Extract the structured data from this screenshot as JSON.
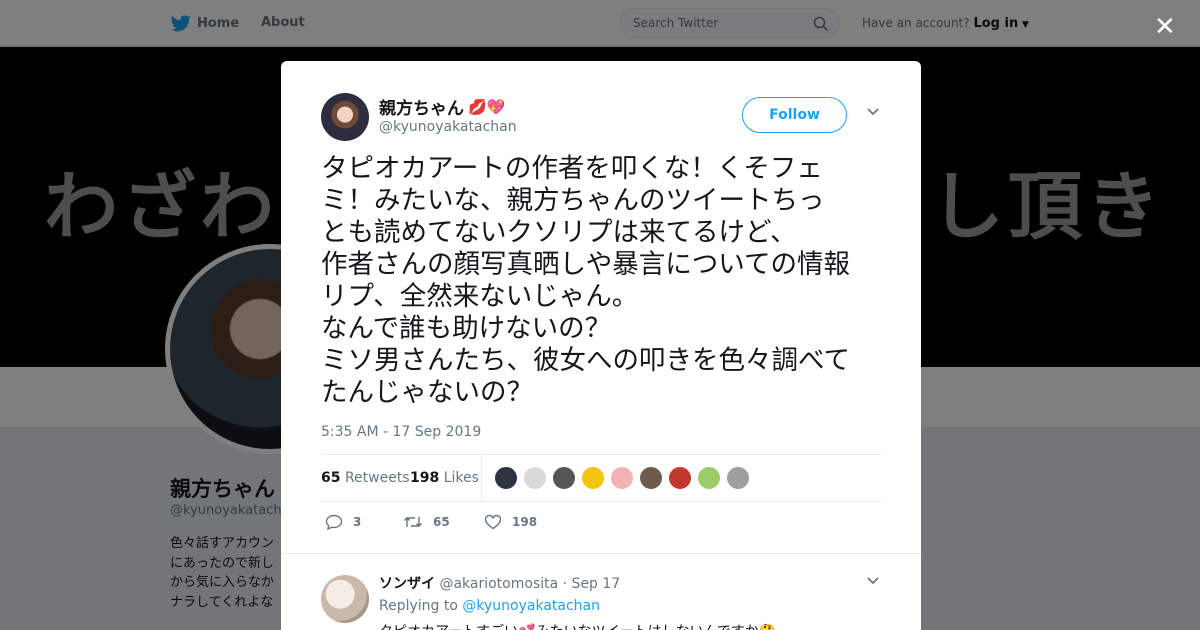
{
  "nav": {
    "home_label": "Home",
    "about_label": "About",
    "search_placeholder": "Search Twitter",
    "account_prompt": "Have an account?",
    "login_label": "Log in"
  },
  "profile": {
    "banner_left_text": "わざわ",
    "banner_right_text": "し頂き",
    "name": "親方ちゃん",
    "handle": "@kyunoyakatacha",
    "bio_lines": [
      "色々話すアカウン",
      "にあったので新し",
      "から気に入らなか",
      "ナラしてくれよな"
    ]
  },
  "tweet": {
    "author_name": "親方ちゃん",
    "author_emoji": "💋💖",
    "author_handle": "@kyunoyakatachan",
    "follow_label": "Follow",
    "text": "タピオカアートの作者を叩くな！くそフェ\nミ！みたいな、親方ちゃんのツイートちっ\nとも読めてないクソリプは来てるけど、\n作者さんの顔写真晒しや暴言についての情報\nリプ、全然来ないじゃん。\nなんで誰も助けないの？\nミソ男さんたち、彼女への叩きを色々調べて\nたんじゃないの？",
    "timestamp": "5:35 AM - 17 Sep 2019",
    "retweets_count": "65",
    "retweets_label": "Retweets",
    "likes_count": "198",
    "likes_label": "Likes",
    "reply_count": "3",
    "retweet_action_count": "65",
    "like_action_count": "198"
  },
  "reply": {
    "name": "ソンザイ",
    "handle": "@akariotomosita",
    "date": "· Sep 17",
    "replying_label": "Replying to",
    "replying_handle": "@kyunoyakatachan",
    "text": "タピオカアートすごい💕みたいなツイートはしないんですか🤔"
  },
  "colors": {
    "twitter_blue": "#1da1f2",
    "text_primary": "#14171a",
    "text_secondary": "#657786"
  }
}
